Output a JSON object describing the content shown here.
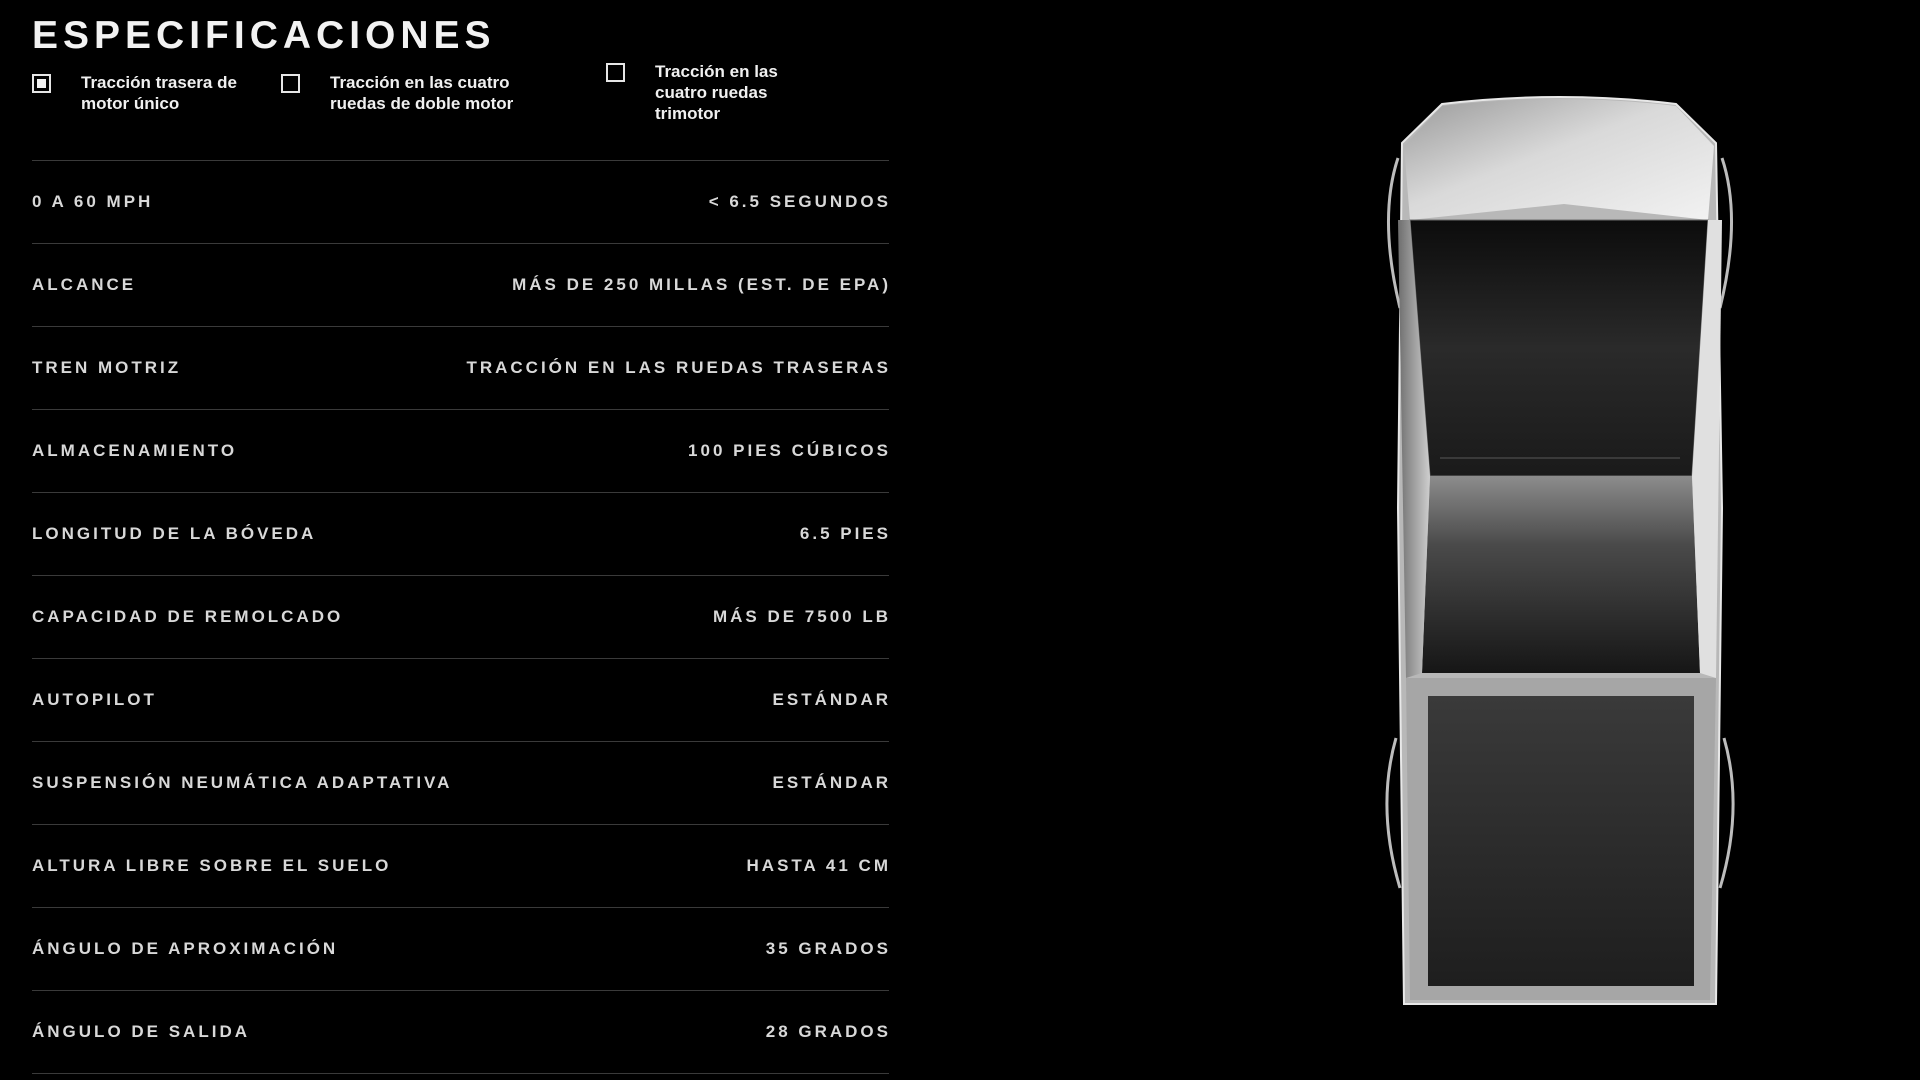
{
  "header": {
    "title": "ESPECIFICACIONES"
  },
  "drivetrain_options": [
    {
      "label": "Tracción trasera de motor único",
      "checked": true
    },
    {
      "label": "Tracción en las cuatro ruedas de doble motor",
      "checked": false
    },
    {
      "label": "Tracción en las cuatro ruedas trimotor",
      "checked": false
    }
  ],
  "specs": [
    {
      "label": "0 A 60 MPH",
      "value": "< 6.5 SEGUNDOS"
    },
    {
      "label": "ALCANCE",
      "value": "MÁS DE 250 MILLAS (EST. DE EPA)"
    },
    {
      "label": "TREN MOTRIZ",
      "value": "TRACCIÓN EN LAS RUEDAS TRASERAS"
    },
    {
      "label": "ALMACENAMIENTO",
      "value": "100 PIES CÚBICOS"
    },
    {
      "label": "LONGITUD DE LA BÓVEDA",
      "value": "6.5 PIES"
    },
    {
      "label": "CAPACIDAD DE REMOLCADO",
      "value": "MÁS DE 7500 LB"
    },
    {
      "label": "AUTOPILOT",
      "value": "ESTÁNDAR"
    },
    {
      "label": "SUSPENSIÓN NEUMÁTICA ADAPTATIVA",
      "value": "ESTÁNDAR"
    },
    {
      "label": "ALTURA LIBRE SOBRE EL SUELO",
      "value": "HASTA 41 CM"
    },
    {
      "label": "ÁNGULO DE APROXIMACIÓN",
      "value": "35 GRADOS"
    },
    {
      "label": "ÁNGULO DE SALIDA",
      "value": "28 GRADOS"
    }
  ],
  "colors": {
    "background": "#000000",
    "text": "#e6e6e6",
    "divider": "#3a3a3a"
  },
  "icons": {
    "truck": "cybertruck-top-view-image",
    "checkbox": "checkbox-icon"
  }
}
